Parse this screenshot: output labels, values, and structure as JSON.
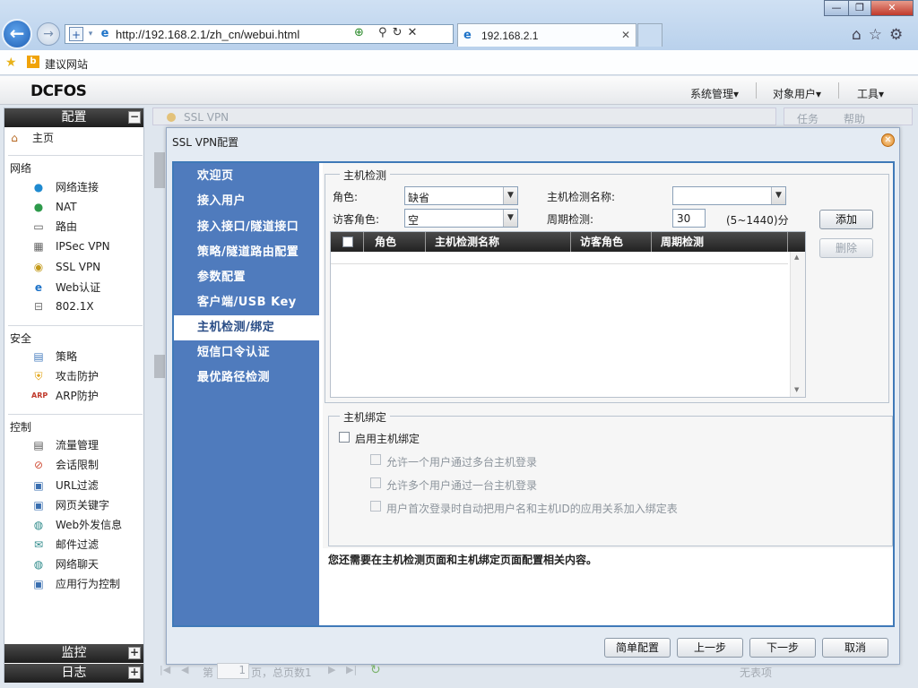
{
  "browser": {
    "url": "http://192.168.2.1/zh_cn/webui.html",
    "tab_title": "192.168.2.1",
    "favorites_label": "建议网站"
  },
  "app": {
    "logo": "DCFOS",
    "menu": [
      "系统管理▾",
      "对象用户▾",
      "工具▾"
    ]
  },
  "sidebar": {
    "config_title": "配置",
    "home": "主页",
    "groups": [
      {
        "title": "网络",
        "items": [
          "网络连接",
          "NAT",
          "路由",
          "IPSec VPN",
          "SSL VPN",
          "Web认证",
          "802.1X"
        ]
      },
      {
        "title": "安全",
        "items": [
          "策略",
          "攻击防护",
          "ARP防护"
        ]
      },
      {
        "title": "控制",
        "items": [
          "流量管理",
          "会话限制",
          "URL过滤",
          "网页关键字",
          "Web外发信息",
          "邮件过滤",
          "网络聊天",
          "应用行为控制"
        ]
      }
    ],
    "monitor_title": "监控",
    "log_title": "日志",
    "toggle_minus": "−",
    "toggle_plus": "+"
  },
  "background": {
    "tab_label": "SSL VPN",
    "right_tabs": [
      "任务",
      "帮助"
    ],
    "pager": {
      "page_prefix": "第",
      "page_value": "1",
      "page_suffix": "页，总页数1",
      "no_items": "无表项"
    }
  },
  "dialog": {
    "title": "SSL VPN配置",
    "steps": [
      "欢迎页",
      "接入用户",
      "接入接口/隧道接口",
      "策略/隧道路由配置",
      "参数配置",
      "客户端/USB Key",
      "主机检测/绑定",
      "短信口令认证",
      "最优路径检测"
    ],
    "active_step": 6,
    "host_check": {
      "legend": "主机检测",
      "role_label": "角色:",
      "role_value": "缺省",
      "guest_role_label": "访客角色:",
      "guest_role_value": "空",
      "check_name_label": "主机检测名称:",
      "check_name_value": "",
      "period_label": "周期检测:",
      "period_value": "30",
      "period_range": "(5~1440)分",
      "add_button": "添加",
      "delete_button": "删除",
      "columns": [
        "角色",
        "主机检测名称",
        "访客角色",
        "周期检测"
      ]
    },
    "host_bind": {
      "legend": "主机绑定",
      "enable_label": "启用主机绑定",
      "options": [
        "允许一个用户通过多台主机登录",
        "允许多个用户通过一台主机登录",
        "用户首次登录时自动把用户名和主机ID的应用关系加入绑定表"
      ]
    },
    "note": "您还需要在主机检测页面和主机绑定页面配置相关内容。",
    "buttons": {
      "simple": "简单配置",
      "prev": "上一步",
      "next": "下一步",
      "cancel": "取消"
    }
  }
}
